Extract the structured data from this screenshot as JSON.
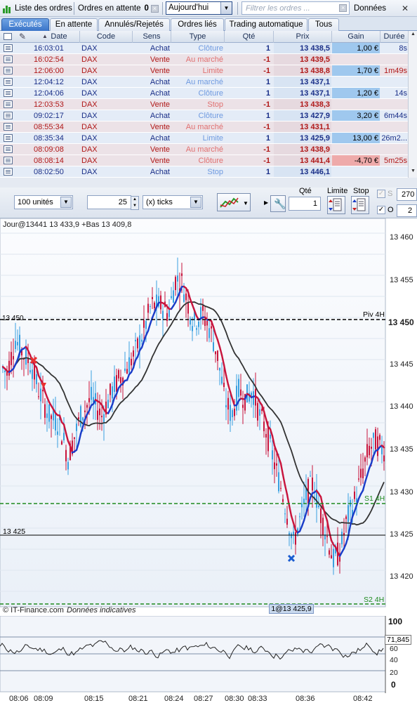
{
  "toolbar": {
    "orders_list_label": "Liste des ordres",
    "pending_label": "Ordres en attente",
    "pending_count": "0",
    "period_value": "Aujourd'hui",
    "filter_placeholder": "Filtrer les ordres ...",
    "data_label": "Données"
  },
  "tabs": [
    "Exécutés",
    "En attente",
    "Annulés/Rejetés",
    "Ordres liés",
    "Trading automatique",
    "Tous"
  ],
  "table": {
    "headers": [
      "Date",
      "Code",
      "Sens",
      "Type",
      "Qté",
      "Prix",
      "Gain",
      "Durée"
    ],
    "rows": [
      {
        "date": "16:03:01",
        "code": "DAX",
        "sens": "Achat",
        "type": "Clôture",
        "qty": "1",
        "price": "13 438,5",
        "gain": "1,00 €",
        "dur": "8s",
        "side": "buy",
        "gs": "pos"
      },
      {
        "date": "16:02:54",
        "code": "DAX",
        "sens": "Vente",
        "type": "Au marché",
        "qty": "-1",
        "price": "13 439,5",
        "gain": "",
        "dur": "",
        "side": "sell",
        "gs": ""
      },
      {
        "date": "12:06:00",
        "code": "DAX",
        "sens": "Vente",
        "type": "Limite",
        "qty": "-1",
        "price": "13 438,8",
        "gain": "1,70 €",
        "dur": "1m49s",
        "side": "sell",
        "gs": "pos"
      },
      {
        "date": "12:04:12",
        "code": "DAX",
        "sens": "Achat",
        "type": "Au marché",
        "qty": "1",
        "price": "13 437,1",
        "gain": "",
        "dur": "",
        "side": "buy",
        "gs": ""
      },
      {
        "date": "12:04:06",
        "code": "DAX",
        "sens": "Achat",
        "type": "Clôture",
        "qty": "1",
        "price": "13 437,1",
        "gain": "1,20 €",
        "dur": "14s",
        "side": "buy",
        "gs": "pos"
      },
      {
        "date": "12:03:53",
        "code": "DAX",
        "sens": "Vente",
        "type": "Stop",
        "qty": "-1",
        "price": "13 438,3",
        "gain": "",
        "dur": "",
        "side": "sell",
        "gs": ""
      },
      {
        "date": "09:02:17",
        "code": "DAX",
        "sens": "Achat",
        "type": "Clôture",
        "qty": "1",
        "price": "13 427,9",
        "gain": "3,20 €",
        "dur": "6m44s",
        "side": "buy",
        "gs": "pos"
      },
      {
        "date": "08:55:34",
        "code": "DAX",
        "sens": "Vente",
        "type": "Au marché",
        "qty": "-1",
        "price": "13 431,1",
        "gain": "",
        "dur": "",
        "side": "sell",
        "gs": ""
      },
      {
        "date": "08:35:34",
        "code": "DAX",
        "sens": "Achat",
        "type": "Limite",
        "qty": "1",
        "price": "13 425,9",
        "gain": "13,00 €",
        "dur": "26m2...",
        "side": "buy",
        "gs": "pos"
      },
      {
        "date": "08:09:08",
        "code": "DAX",
        "sens": "Vente",
        "type": "Au marché",
        "qty": "-1",
        "price": "13 438,9",
        "gain": "",
        "dur": "",
        "side": "sell",
        "gs": ""
      },
      {
        "date": "08:08:14",
        "code": "DAX",
        "sens": "Vente",
        "type": "Clôture",
        "qty": "-1",
        "price": "13 441,4",
        "gain": "-4,70 €",
        "dur": "5m25s",
        "side": "sell",
        "gs": "neg"
      },
      {
        "date": "08:02:50",
        "code": "DAX",
        "sens": "Achat",
        "type": "Stop",
        "qty": "1",
        "price": "13 446,1",
        "gain": "",
        "dur": "",
        "side": "buy",
        "gs": ""
      }
    ]
  },
  "chart_controls": {
    "units_value": "100 unités",
    "ticks_value": "25",
    "ticks_unit": "(x) ticks",
    "qty_label": "Qté",
    "qty_value": "1",
    "limit_label": "Limite",
    "stop_label": "Stop",
    "s_label": "S",
    "s_value": "270",
    "o_label": "O",
    "o_value": "2"
  },
  "chart": {
    "header_text": "Jour@13441 13 433,9 +Bas 13 409,8",
    "pivot_label": "Piv 4H",
    "pivot_value_left": "13 450",
    "pivot_value_right": "13 450",
    "s1_label": "S1 4H",
    "s2_label": "S2 4H",
    "hline_label": "13 425",
    "position_label": "1@13 425,9",
    "footer_source": "© IT-Finance.com",
    "footer_note": "Données indicatives",
    "y_ticks": [
      "13 460",
      "13 455",
      "13 445",
      "13 440",
      "13 435",
      "13 430",
      "13 425",
      "13 420"
    ],
    "x_ticks": [
      "08:06",
      "08:09",
      "08:15",
      "08:21",
      "08:24",
      "08:27",
      "08:30",
      "08:33",
      "08:36",
      "08:42"
    ],
    "osc_value": "71,845",
    "osc_ticks": [
      "100",
      "80",
      "60",
      "40",
      "20",
      "0"
    ],
    "colors": {
      "ma_fast": "#1a3cc8",
      "ma_fast_down": "#c8143c",
      "ma_slow": "#333333",
      "pivot": "#000000",
      "support": "#1e8a1e"
    }
  }
}
